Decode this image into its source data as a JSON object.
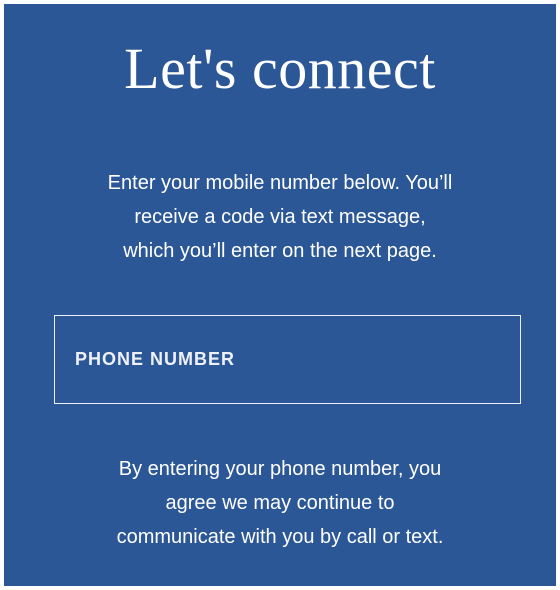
{
  "title": "Let's connect",
  "intro": {
    "line1": "Enter your mobile number below. You’ll",
    "line2": "receive a code via text message,",
    "line3": "which you’ll enter on the next page."
  },
  "phone_field": {
    "placeholder": "PHONE NUMBER",
    "value": ""
  },
  "consent": {
    "line1": "By entering your phone number, you",
    "line2": "agree we may continue to",
    "line3": "communicate with you by call or text."
  },
  "colors": {
    "panel_background": "#2b5797",
    "text": "#ffffff"
  }
}
